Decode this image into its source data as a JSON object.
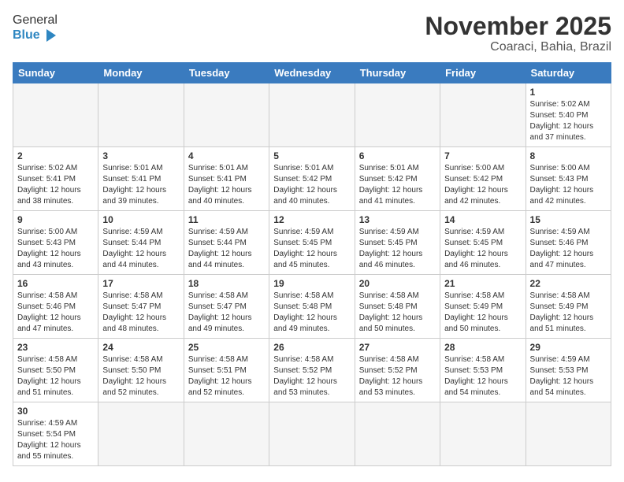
{
  "header": {
    "logo_general": "General",
    "logo_blue": "Blue",
    "title": "November 2025",
    "subtitle": "Coaraci, Bahia, Brazil"
  },
  "weekdays": [
    "Sunday",
    "Monday",
    "Tuesday",
    "Wednesday",
    "Thursday",
    "Friday",
    "Saturday"
  ],
  "days": [
    {
      "day": "",
      "empty": true
    },
    {
      "day": "",
      "empty": true
    },
    {
      "day": "",
      "empty": true
    },
    {
      "day": "",
      "empty": true
    },
    {
      "day": "",
      "empty": true
    },
    {
      "day": "",
      "empty": true
    },
    {
      "day": "1",
      "sunrise": "5:02 AM",
      "sunset": "5:40 PM",
      "daylight": "12 hours and 37 minutes."
    },
    {
      "day": "2",
      "sunrise": "5:02 AM",
      "sunset": "5:41 PM",
      "daylight": "12 hours and 38 minutes."
    },
    {
      "day": "3",
      "sunrise": "5:01 AM",
      "sunset": "5:41 PM",
      "daylight": "12 hours and 39 minutes."
    },
    {
      "day": "4",
      "sunrise": "5:01 AM",
      "sunset": "5:41 PM",
      "daylight": "12 hours and 40 minutes."
    },
    {
      "day": "5",
      "sunrise": "5:01 AM",
      "sunset": "5:42 PM",
      "daylight": "12 hours and 40 minutes."
    },
    {
      "day": "6",
      "sunrise": "5:01 AM",
      "sunset": "5:42 PM",
      "daylight": "12 hours and 41 minutes."
    },
    {
      "day": "7",
      "sunrise": "5:00 AM",
      "sunset": "5:42 PM",
      "daylight": "12 hours and 42 minutes."
    },
    {
      "day": "8",
      "sunrise": "5:00 AM",
      "sunset": "5:43 PM",
      "daylight": "12 hours and 42 minutes."
    },
    {
      "day": "9",
      "sunrise": "5:00 AM",
      "sunset": "5:43 PM",
      "daylight": "12 hours and 43 minutes."
    },
    {
      "day": "10",
      "sunrise": "4:59 AM",
      "sunset": "5:44 PM",
      "daylight": "12 hours and 44 minutes."
    },
    {
      "day": "11",
      "sunrise": "4:59 AM",
      "sunset": "5:44 PM",
      "daylight": "12 hours and 44 minutes."
    },
    {
      "day": "12",
      "sunrise": "4:59 AM",
      "sunset": "5:45 PM",
      "daylight": "12 hours and 45 minutes."
    },
    {
      "day": "13",
      "sunrise": "4:59 AM",
      "sunset": "5:45 PM",
      "daylight": "12 hours and 46 minutes."
    },
    {
      "day": "14",
      "sunrise": "4:59 AM",
      "sunset": "5:45 PM",
      "daylight": "12 hours and 46 minutes."
    },
    {
      "day": "15",
      "sunrise": "4:59 AM",
      "sunset": "5:46 PM",
      "daylight": "12 hours and 47 minutes."
    },
    {
      "day": "16",
      "sunrise": "4:58 AM",
      "sunset": "5:46 PM",
      "daylight": "12 hours and 47 minutes."
    },
    {
      "day": "17",
      "sunrise": "4:58 AM",
      "sunset": "5:47 PM",
      "daylight": "12 hours and 48 minutes."
    },
    {
      "day": "18",
      "sunrise": "4:58 AM",
      "sunset": "5:47 PM",
      "daylight": "12 hours and 49 minutes."
    },
    {
      "day": "19",
      "sunrise": "4:58 AM",
      "sunset": "5:48 PM",
      "daylight": "12 hours and 49 minutes."
    },
    {
      "day": "20",
      "sunrise": "4:58 AM",
      "sunset": "5:48 PM",
      "daylight": "12 hours and 50 minutes."
    },
    {
      "day": "21",
      "sunrise": "4:58 AM",
      "sunset": "5:49 PM",
      "daylight": "12 hours and 50 minutes."
    },
    {
      "day": "22",
      "sunrise": "4:58 AM",
      "sunset": "5:49 PM",
      "daylight": "12 hours and 51 minutes."
    },
    {
      "day": "23",
      "sunrise": "4:58 AM",
      "sunset": "5:50 PM",
      "daylight": "12 hours and 51 minutes."
    },
    {
      "day": "24",
      "sunrise": "4:58 AM",
      "sunset": "5:50 PM",
      "daylight": "12 hours and 52 minutes."
    },
    {
      "day": "25",
      "sunrise": "4:58 AM",
      "sunset": "5:51 PM",
      "daylight": "12 hours and 52 minutes."
    },
    {
      "day": "26",
      "sunrise": "4:58 AM",
      "sunset": "5:52 PM",
      "daylight": "12 hours and 53 minutes."
    },
    {
      "day": "27",
      "sunrise": "4:58 AM",
      "sunset": "5:52 PM",
      "daylight": "12 hours and 53 minutes."
    },
    {
      "day": "28",
      "sunrise": "4:58 AM",
      "sunset": "5:53 PM",
      "daylight": "12 hours and 54 minutes."
    },
    {
      "day": "29",
      "sunrise": "4:59 AM",
      "sunset": "5:53 PM",
      "daylight": "12 hours and 54 minutes."
    },
    {
      "day": "30",
      "sunrise": "4:59 AM",
      "sunset": "5:54 PM",
      "daylight": "12 hours and 55 minutes."
    },
    {
      "day": "",
      "empty": true
    },
    {
      "day": "",
      "empty": true
    },
    {
      "day": "",
      "empty": true
    },
    {
      "day": "",
      "empty": true
    },
    {
      "day": "",
      "empty": true
    },
    {
      "day": "",
      "empty": true
    }
  ]
}
